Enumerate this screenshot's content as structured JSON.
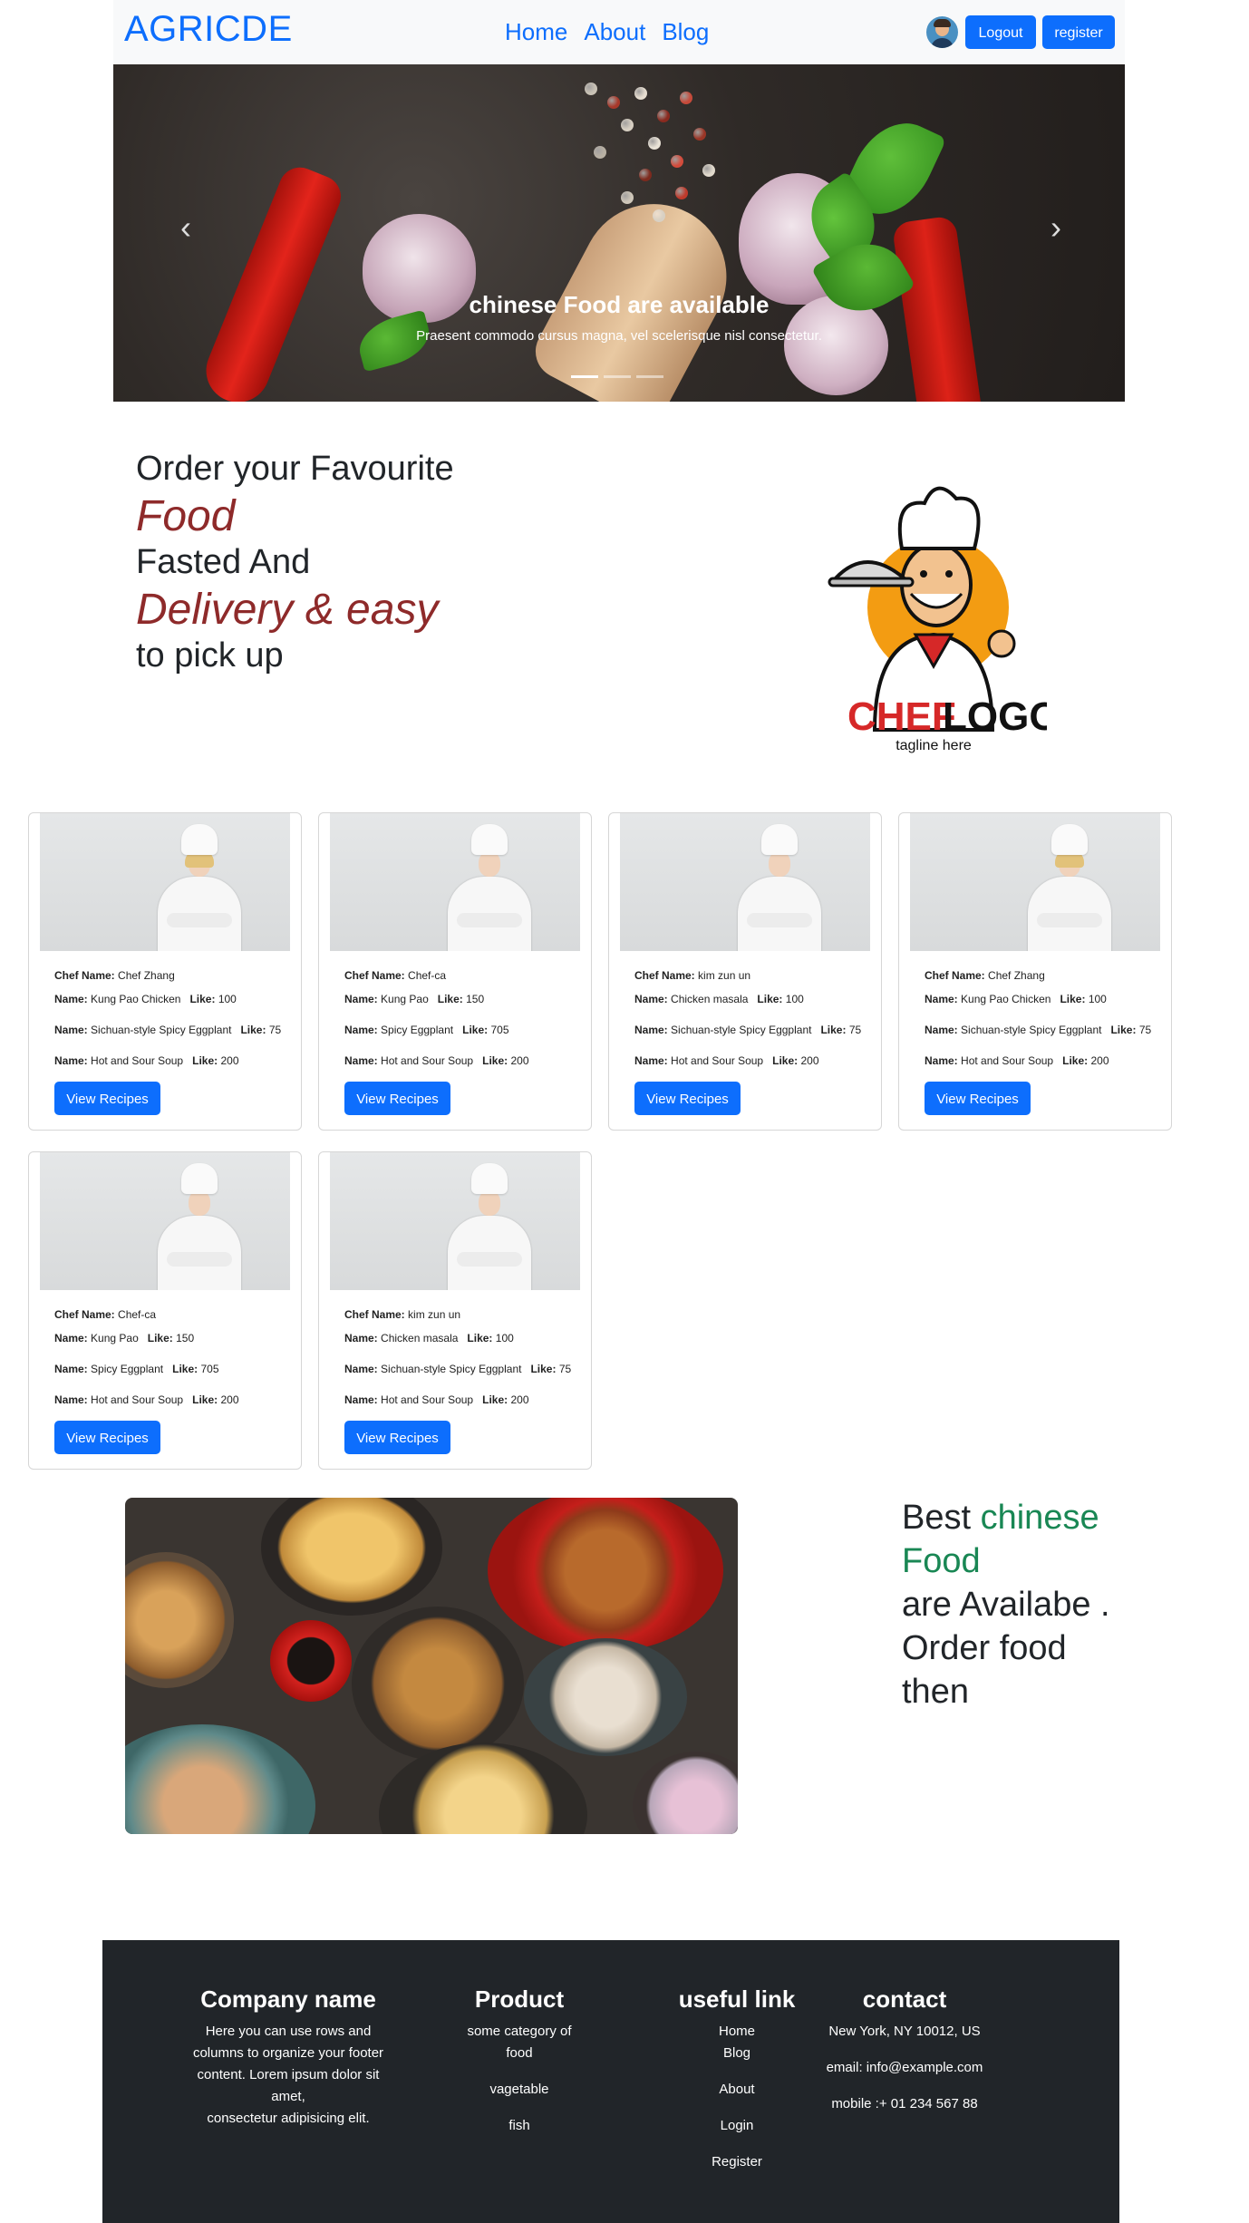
{
  "nav": {
    "brand": "AGRICDE",
    "links": [
      "Home",
      "About",
      "Blog"
    ],
    "logout": "Logout",
    "register": "register"
  },
  "carousel": {
    "caption_title": "chinese Food are available",
    "caption_text": "Praesent commodo cursus magna, vel scelerisque nisl consectetur.",
    "prev": "‹",
    "next": "›",
    "slides": 3,
    "active_slide": 1
  },
  "hero": {
    "line1": "Order your Favourite",
    "accent1": "Food",
    "line2": "Fasted And",
    "accent2": "Delivery & easy",
    "line3": "to pick up",
    "logo_chef": "CHEF",
    "logo_word": "LOGO",
    "logo_tagline": "tagline here"
  },
  "labels": {
    "chef_name": "Chef Name:",
    "name": "Name:",
    "like": "Like:",
    "view": "View Recipes"
  },
  "chefs": [
    {
      "chef": "Chef Zhang",
      "gender": "f",
      "r": [
        [
          "Kung Pao Chicken",
          "100"
        ],
        [
          "Sichuan-style Spicy Eggplant",
          "75"
        ],
        [
          "Hot and Sour Soup",
          "200"
        ]
      ]
    },
    {
      "chef": "Chef-ca",
      "gender": "m",
      "r": [
        [
          "Kung Pao",
          "150"
        ],
        [
          "Spicy Eggplant",
          "705"
        ],
        [
          "Hot and Sour Soup",
          "200"
        ]
      ]
    },
    {
      "chef": "kim zun un",
      "gender": "m",
      "r": [
        [
          "Chicken masala",
          "100"
        ],
        [
          "Sichuan-style Spicy Eggplant",
          "75"
        ],
        [
          "Hot and Sour Soup",
          "200"
        ]
      ]
    },
    {
      "chef": "Chef Zhang",
      "gender": "f",
      "r": [
        [
          "Kung Pao Chicken",
          "100"
        ],
        [
          "Sichuan-style Spicy Eggplant",
          "75"
        ],
        [
          "Hot and Sour Soup",
          "200"
        ]
      ]
    },
    {
      "chef": "Chef-ca",
      "gender": "m",
      "r": [
        [
          "Kung Pao",
          "150"
        ],
        [
          "Spicy Eggplant",
          "705"
        ],
        [
          "Hot and Sour Soup",
          "200"
        ]
      ]
    },
    {
      "chef": "kim zun un",
      "gender": "m",
      "r": [
        [
          "Chicken masala",
          "100"
        ],
        [
          "Sichuan-style Spicy Eggplant",
          "75"
        ],
        [
          "Hot and Sour Soup",
          "200"
        ]
      ]
    }
  ],
  "food": {
    "best": "Best",
    "chinese": "chinese",
    "food": "Food",
    "l2": "are Availabe .",
    "l3": "Order food",
    "l4": "then"
  },
  "footer": {
    "company_title": "Company name",
    "company_lines": [
      "Here you can use rows and",
      "columns to organize your footer",
      "content. Lorem ipsum dolor sit",
      "amet,",
      "consectetur adipisicing elit."
    ],
    "product_title": "Product",
    "product_items": [
      "some category of food",
      "vagetable",
      "fish"
    ],
    "links_title": "useful link",
    "links": [
      "Home",
      "Blog",
      "About",
      "Login",
      "Register"
    ],
    "contact_title": "contact",
    "address": "New York, NY 10012, US",
    "email": "email: info@example.com",
    "mobile": "mobile :+ 01 234 567 88"
  },
  "colors": {
    "primary": "#0d6efd",
    "accent_red": "#8e2a2a",
    "accent_green": "#198754",
    "footer_bg": "#212529"
  }
}
